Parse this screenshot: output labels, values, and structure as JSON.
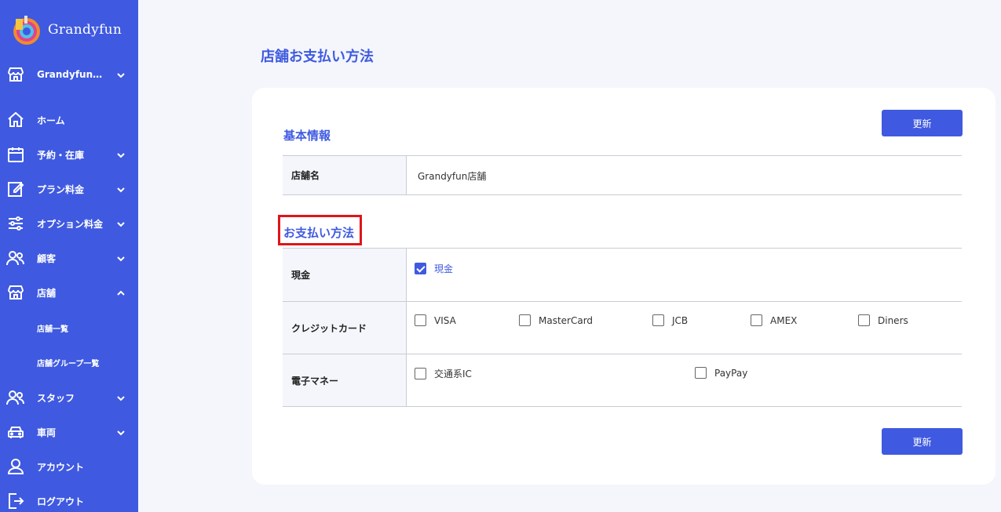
{
  "brand": {
    "name": "Grandyfun"
  },
  "sidebar": {
    "items": [
      {
        "label": "Grandyfun…",
        "icon": "store-icon"
      },
      {
        "label": "ホーム",
        "icon": "home-icon"
      },
      {
        "label": "予約・在庫",
        "icon": "calendar-icon"
      },
      {
        "label": "プラン料金",
        "icon": "edit-icon"
      },
      {
        "label": "オプション料金",
        "icon": "sliders-icon"
      },
      {
        "label": "顧客",
        "icon": "users-icon"
      },
      {
        "label": "店舗",
        "icon": "store-icon"
      },
      {
        "label": "スタッフ",
        "icon": "users-icon"
      },
      {
        "label": "車両",
        "icon": "car-icon"
      },
      {
        "label": "アカウント",
        "icon": "user-icon"
      },
      {
        "label": "ログアウト",
        "icon": "logout-icon"
      }
    ],
    "sub_items": [
      {
        "label": "店舗一覧"
      },
      {
        "label": "店舗グループ一覧"
      }
    ]
  },
  "page": {
    "title": "店舗お支払い方法"
  },
  "basic": {
    "title": "基本情報",
    "store_name_label": "店舗名",
    "store_name_value": "Grandyfun店舗"
  },
  "payment": {
    "title": "お支払い方法",
    "cash": {
      "label": "現金",
      "options": [
        {
          "label": "現金",
          "checked": true
        }
      ]
    },
    "credit": {
      "label": "クレジットカード",
      "options": [
        {
          "label": "VISA",
          "checked": false
        },
        {
          "label": "MasterCard",
          "checked": false
        },
        {
          "label": "JCB",
          "checked": false
        },
        {
          "label": "AMEX",
          "checked": false
        },
        {
          "label": "Diners",
          "checked": false
        }
      ]
    },
    "emoney": {
      "label": "電子マネー",
      "options": [
        {
          "label": "交通系IC",
          "checked": false
        },
        {
          "label": "PayPay",
          "checked": false
        }
      ]
    }
  },
  "buttons": {
    "update_label": "更新"
  },
  "colors": {
    "accent": "#3f5ae0",
    "highlight": "#e0141b"
  }
}
